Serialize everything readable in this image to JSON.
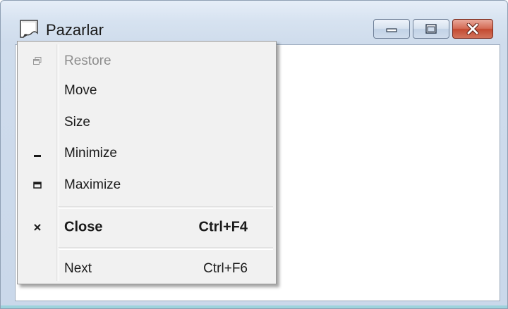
{
  "window": {
    "title": "Pazarlar",
    "icon": "document-icon"
  },
  "caption_buttons": {
    "minimize_icon": "minimize-icon",
    "restore_icon": "restore-icon",
    "close_icon": "close-icon"
  },
  "system_menu": {
    "items": [
      {
        "label": "Restore",
        "icon": "restore-icon",
        "enabled": false
      },
      {
        "label": "Move",
        "enabled": true
      },
      {
        "label": "Size",
        "enabled": true
      },
      {
        "label": "Minimize",
        "icon": "minimize-icon",
        "enabled": true
      },
      {
        "label": "Maximize",
        "icon": "maximize-icon",
        "enabled": true
      },
      {
        "label": "Close",
        "shortcut": "Ctrl+F4",
        "icon": "close-icon",
        "enabled": true,
        "default": true
      },
      {
        "label": "Next",
        "shortcut": "Ctrl+F6",
        "enabled": true
      }
    ]
  },
  "colors": {
    "close_button": "#c34a31",
    "menu_background": "#f1f1f1",
    "disabled_text": "#8d8d8d",
    "bottom_strip": "#9dd3dc"
  }
}
